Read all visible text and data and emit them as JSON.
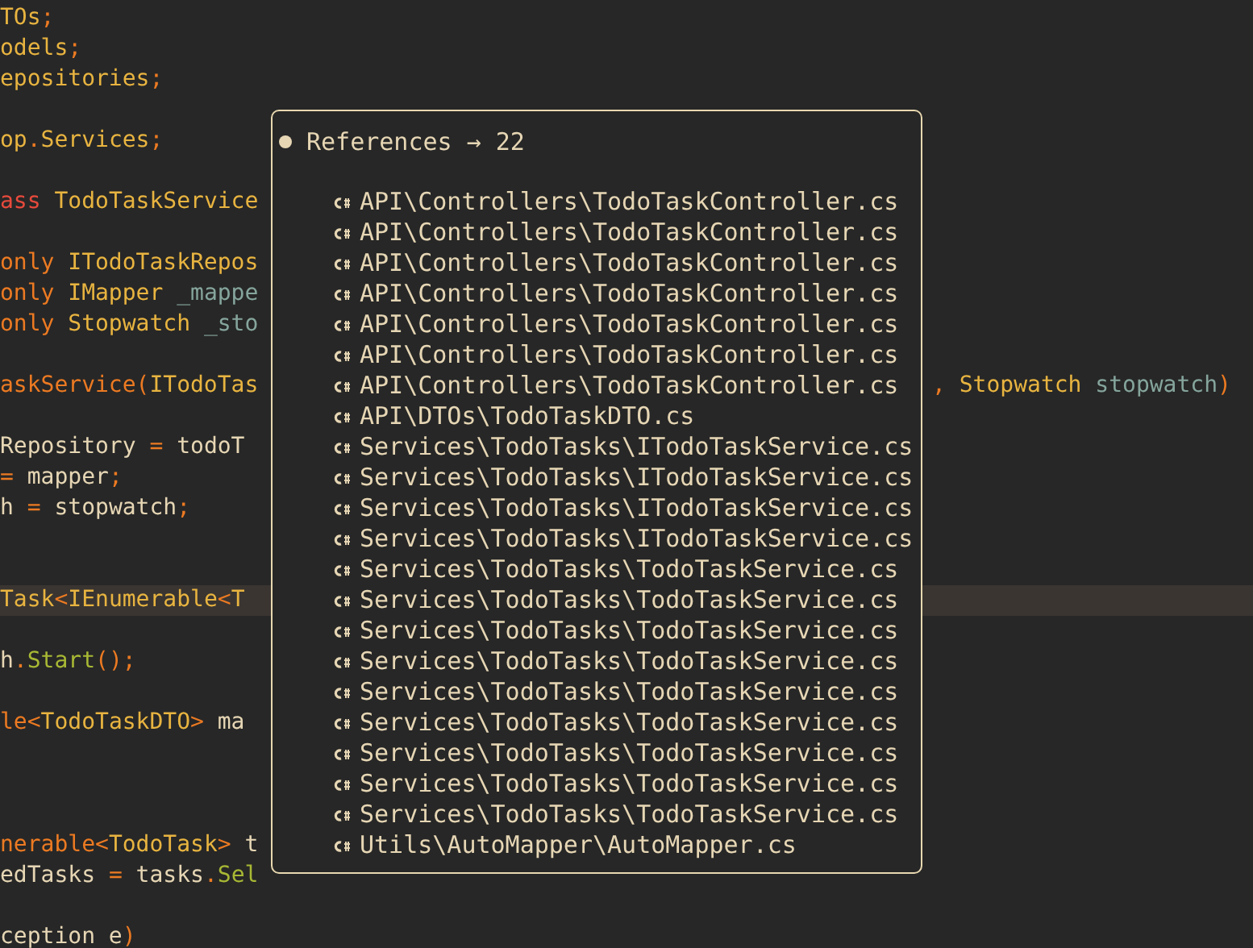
{
  "editor": {
    "lines": [
      {
        "kind": "code",
        "current": false,
        "tokens": [
          {
            "kind": "type",
            "text": "TOs"
          },
          {
            "kind": "punc",
            "text": ";"
          }
        ]
      },
      {
        "kind": "code",
        "current": false,
        "tokens": [
          {
            "kind": "type",
            "text": "odels"
          },
          {
            "kind": "punc",
            "text": ";"
          }
        ]
      },
      {
        "kind": "code",
        "current": false,
        "tokens": [
          {
            "kind": "type",
            "text": "epositories"
          },
          {
            "kind": "punc",
            "text": ";"
          }
        ]
      },
      {
        "kind": "blank",
        "current": false
      },
      {
        "kind": "code",
        "current": false,
        "tokens": [
          {
            "kind": "type",
            "text": "op"
          },
          {
            "kind": "punc",
            "text": "."
          },
          {
            "kind": "type",
            "text": "Services"
          },
          {
            "kind": "punc",
            "text": ";"
          }
        ]
      },
      {
        "kind": "blank",
        "current": false
      },
      {
        "kind": "code",
        "current": false,
        "tokens": [
          {
            "kind": "kw",
            "text": "ass"
          },
          {
            "kind": "type",
            "text": " TodoTaskService"
          }
        ]
      },
      {
        "kind": "blank",
        "current": false
      },
      {
        "kind": "code",
        "current": false,
        "tokens": [
          {
            "kind": "punc",
            "text": "only"
          },
          {
            "kind": "type",
            "text": " ITodoTaskRepos"
          }
        ]
      },
      {
        "kind": "code",
        "current": false,
        "tokens": [
          {
            "kind": "punc",
            "text": "only"
          },
          {
            "kind": "type",
            "text": " IMapper"
          },
          {
            "kind": "field",
            "text": " _mappe"
          }
        ]
      },
      {
        "kind": "code",
        "current": false,
        "tokens": [
          {
            "kind": "punc",
            "text": "only"
          },
          {
            "kind": "type",
            "text": " Stopwatch"
          },
          {
            "kind": "field",
            "text": " _sto"
          }
        ]
      },
      {
        "kind": "blank",
        "current": false
      },
      {
        "kind": "code",
        "current": false,
        "tokens": [
          {
            "kind": "punc",
            "text": "askService("
          },
          {
            "kind": "type",
            "text": "ITodoTas"
          }
        ],
        "right_tokens": [
          {
            "kind": "punc",
            "text": ","
          },
          {
            "kind": "type",
            "text": " Stopwatch"
          },
          {
            "kind": "field",
            "text": " stopwatch"
          },
          {
            "kind": "punc",
            "text": ")"
          }
        ]
      },
      {
        "kind": "blank",
        "current": false
      },
      {
        "kind": "code",
        "current": false,
        "tokens": [
          {
            "kind": "text",
            "text": "Repository "
          },
          {
            "kind": "punc",
            "text": "="
          },
          {
            "kind": "text",
            "text": " todoT"
          }
        ]
      },
      {
        "kind": "code",
        "current": false,
        "tokens": [
          {
            "kind": "punc",
            "text": "="
          },
          {
            "kind": "text",
            "text": " mapper"
          },
          {
            "kind": "punc",
            "text": ";"
          }
        ]
      },
      {
        "kind": "code",
        "current": false,
        "tokens": [
          {
            "kind": "text",
            "text": "h "
          },
          {
            "kind": "punc",
            "text": "="
          },
          {
            "kind": "text",
            "text": " stopwatch"
          },
          {
            "kind": "punc",
            "text": ";"
          }
        ]
      },
      {
        "kind": "blank",
        "current": false
      },
      {
        "kind": "blank",
        "current": false
      },
      {
        "kind": "code",
        "current": true,
        "tokens": [
          {
            "kind": "type",
            "text": "Task"
          },
          {
            "kind": "punc",
            "text": "<"
          },
          {
            "kind": "type",
            "text": "IEnumerable"
          },
          {
            "kind": "punc",
            "text": "<"
          },
          {
            "kind": "type",
            "text": "T"
          }
        ]
      },
      {
        "kind": "blank",
        "current": false
      },
      {
        "kind": "code",
        "current": false,
        "tokens": [
          {
            "kind": "text",
            "text": "h"
          },
          {
            "kind": "punc",
            "text": "."
          },
          {
            "kind": "method",
            "text": "Start"
          },
          {
            "kind": "punc",
            "text": "();"
          }
        ]
      },
      {
        "kind": "blank",
        "current": false
      },
      {
        "kind": "code",
        "current": false,
        "tokens": [
          {
            "kind": "punc",
            "text": "le<"
          },
          {
            "kind": "type",
            "text": "TodoTaskDTO"
          },
          {
            "kind": "punc",
            "text": ">"
          },
          {
            "kind": "text",
            "text": " ma"
          }
        ]
      },
      {
        "kind": "blank",
        "current": false
      },
      {
        "kind": "blank",
        "current": false
      },
      {
        "kind": "blank",
        "current": false
      },
      {
        "kind": "code",
        "current": false,
        "tokens": [
          {
            "kind": "punc",
            "text": "nerable<"
          },
          {
            "kind": "type",
            "text": "TodoTask"
          },
          {
            "kind": "punc",
            "text": ">"
          },
          {
            "kind": "text",
            "text": " t"
          }
        ]
      },
      {
        "kind": "code",
        "current": false,
        "tokens": [
          {
            "kind": "text",
            "text": "edTasks "
          },
          {
            "kind": "punc",
            "text": "="
          },
          {
            "kind": "text",
            "text": " tasks"
          },
          {
            "kind": "punc",
            "text": "."
          },
          {
            "kind": "method",
            "text": "Sel"
          }
        ]
      },
      {
        "kind": "blank",
        "current": false
      },
      {
        "kind": "code",
        "current": false,
        "tokens": [
          {
            "kind": "text",
            "text": "ception e"
          },
          {
            "kind": "punc",
            "text": ")"
          }
        ]
      }
    ]
  },
  "references_popup": {
    "title": "References → 22",
    "items": [
      "API\\Controllers\\TodoTaskController.cs",
      "API\\Controllers\\TodoTaskController.cs",
      "API\\Controllers\\TodoTaskController.cs",
      "API\\Controllers\\TodoTaskController.cs",
      "API\\Controllers\\TodoTaskController.cs",
      "API\\Controllers\\TodoTaskController.cs",
      "API\\Controllers\\TodoTaskController.cs",
      "API\\DTOs\\TodoTaskDTO.cs",
      "Services\\TodoTasks\\ITodoTaskService.cs",
      "Services\\TodoTasks\\ITodoTaskService.cs",
      "Services\\TodoTasks\\ITodoTaskService.cs",
      "Services\\TodoTasks\\ITodoTaskService.cs",
      "Services\\TodoTasks\\TodoTaskService.cs",
      "Services\\TodoTasks\\TodoTaskService.cs",
      "Services\\TodoTasks\\TodoTaskService.cs",
      "Services\\TodoTasks\\TodoTaskService.cs",
      "Services\\TodoTasks\\TodoTaskService.cs",
      "Services\\TodoTasks\\TodoTaskService.cs",
      "Services\\TodoTasks\\TodoTaskService.cs",
      "Services\\TodoTasks\\TodoTaskService.cs",
      "Services\\TodoTasks\\TodoTaskService.cs",
      "Utils\\AutoMapper\\AutoMapper.cs"
    ]
  }
}
